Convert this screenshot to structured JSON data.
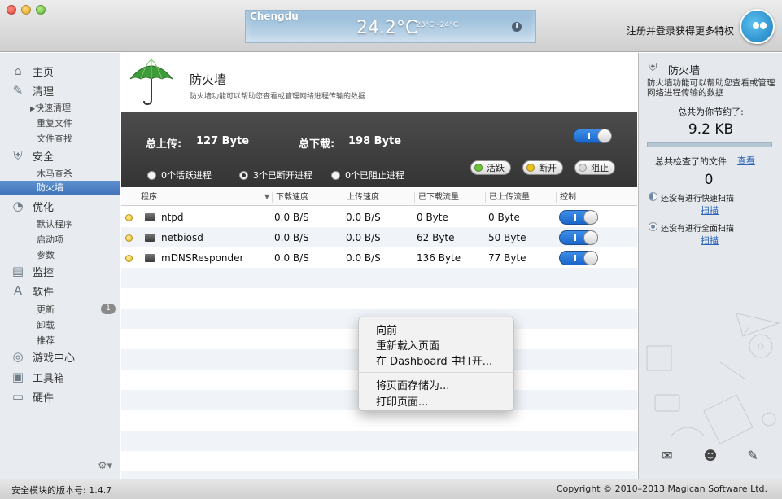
{
  "titlebar": {
    "weather": {
      "city": "Chengdu",
      "temp": "24.2°C",
      "range": "23°C~24°C"
    },
    "register_text": "注册并登录获得更多特权"
  },
  "sidebar": {
    "home": "主页",
    "clean": {
      "label": "清理",
      "items": [
        "快速清理",
        "重复文件",
        "文件查找"
      ]
    },
    "security": {
      "label": "安全",
      "items": [
        "木马查杀",
        "防火墙"
      ],
      "selected": "防火墙"
    },
    "optimize": {
      "label": "优化",
      "items": [
        "默认程序",
        "启动项",
        "参数"
      ]
    },
    "monitor": "监控",
    "software": {
      "label": "软件",
      "items": [
        "更新",
        "卸载",
        "推荐"
      ],
      "update_badge": "1"
    },
    "game_center": "游戏中心",
    "toolbox": "工具箱",
    "hardware": "硬件"
  },
  "firewall": {
    "title": "防火墙",
    "description": "防火墙功能可以帮助您查看或管理网络进程传输的数据",
    "total_upload_label": "总上传:",
    "total_upload_value": "127 Byte",
    "total_download_label": "总下载:",
    "total_download_value": "198 Byte",
    "master_toggle": "on",
    "filters": [
      "0个活跃进程",
      "3个已断开进程",
      "0个已阻止进程"
    ],
    "selected_filter": "3个已断开进程",
    "legend": [
      {
        "label": "活跃",
        "color": "#6cc23a"
      },
      {
        "label": "断开",
        "color": "#e8c020"
      },
      {
        "label": "阻止",
        "color": "#d8d8d8"
      }
    ]
  },
  "table": {
    "columns": [
      "程序",
      "下载速度",
      "上传速度",
      "已下载流量",
      "已上传流量",
      "控制"
    ],
    "rows": [
      {
        "name": "ntpd",
        "down_speed": "0.0 B/S",
        "up_speed": "0.0 B/S",
        "downloaded": "0 Byte",
        "uploaded": "0 Byte",
        "control": "on"
      },
      {
        "name": "netbiosd",
        "down_speed": "0.0 B/S",
        "up_speed": "0.0 B/S",
        "downloaded": "62 Byte",
        "uploaded": "50 Byte",
        "control": "on"
      },
      {
        "name": "mDNSResponder",
        "down_speed": "0.0 B/S",
        "up_speed": "0.0 B/S",
        "downloaded": "136 Byte",
        "uploaded": "77 Byte",
        "control": "on"
      }
    ]
  },
  "context_menu": {
    "items": [
      "向前",
      "重新载入页面",
      "在 Dashboard 中打开...",
      "将页面存储为...",
      "打印页面..."
    ]
  },
  "right_panel": {
    "title": "防火墙",
    "description": "防火墙功能可以帮助您查看或管理网络进程传输的数据",
    "saved_label": "总共为你节约了:",
    "saved_value": "9.2 KB",
    "checked_label": "总共检查了的文件",
    "view_link": "查看",
    "checked_count": "0",
    "quick_scan_text": "还没有进行快速扫描",
    "quick_scan_link": "扫描",
    "full_scan_text": "还没有进行全面扫描",
    "full_scan_link": "扫描"
  },
  "statusbar": {
    "version": "安全模块的版本号: 1.4.7",
    "copyright": "Copyright © 2010–2013 Magican Software Ltd."
  }
}
